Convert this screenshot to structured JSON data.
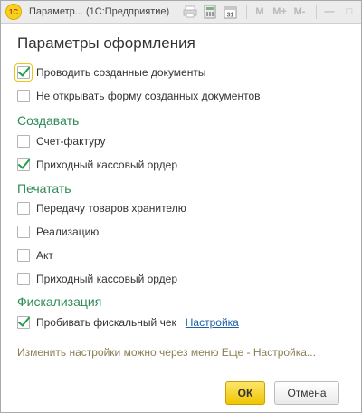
{
  "window": {
    "logo_text": "1С",
    "title": "Параметр... (1С:Предприятие)",
    "toolbar": {
      "m": "M",
      "mplus": "M+",
      "mminus": "M-"
    },
    "controls": {
      "minimize": "—",
      "maximize": "□",
      "close": "✕"
    }
  },
  "heading": "Параметры оформления",
  "options": [
    {
      "label": "Проводить созданные документы",
      "checked": true
    },
    {
      "label": "Не открывать форму созданных документов",
      "checked": false
    }
  ],
  "sections": {
    "create": {
      "title": "Создавать",
      "items": [
        {
          "label": "Счет-фактуру",
          "checked": false
        },
        {
          "label": "Приходный кассовый ордер",
          "checked": true
        }
      ]
    },
    "print": {
      "title": "Печатать",
      "items": [
        {
          "label": "Передачу товаров хранителю",
          "checked": false
        },
        {
          "label": "Реализацию",
          "checked": false
        },
        {
          "label": "Акт",
          "checked": false
        },
        {
          "label": "Приходный кассовый ордер",
          "checked": false
        }
      ]
    },
    "fiscal": {
      "title": "Фискализация",
      "items": [
        {
          "label": "Пробивать фискальный чек",
          "checked": true,
          "link": "Настройка"
        }
      ]
    }
  },
  "hint": "Изменить настройки можно через меню Еще - Настройка...",
  "buttons": {
    "ok": "ОК",
    "cancel": "Отмена"
  }
}
